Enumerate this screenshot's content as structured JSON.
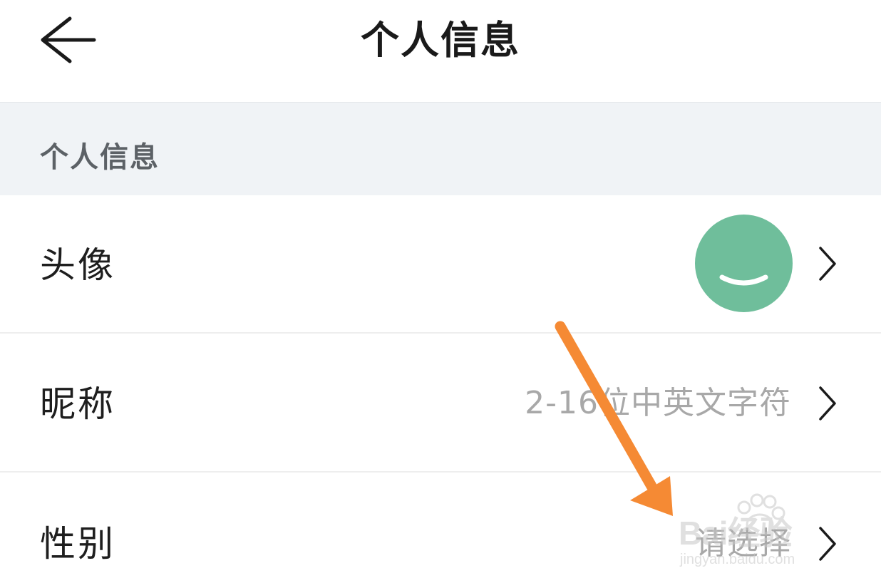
{
  "header": {
    "title": "个人信息",
    "back_icon": "back-arrow-icon"
  },
  "section": {
    "title": "个人信息"
  },
  "rows": [
    {
      "label": "头像",
      "value": "",
      "icon": "chevron-right-icon",
      "avatar_color": "#6fbe9b"
    },
    {
      "label": "昵称",
      "value": "2-16位中英文字符",
      "icon": "chevron-right-icon"
    },
    {
      "label": "性别",
      "value": "请选择",
      "icon": "chevron-right-icon"
    }
  ],
  "annotation": {
    "arrow_color": "#f58a34"
  },
  "watermark": {
    "text": "Bai经验",
    "sub": "jingyan.baidu.com"
  },
  "colors": {
    "section_bg": "#f0f3f6",
    "placeholder_text": "#a8a8a8",
    "divider": "#eeeeee"
  }
}
